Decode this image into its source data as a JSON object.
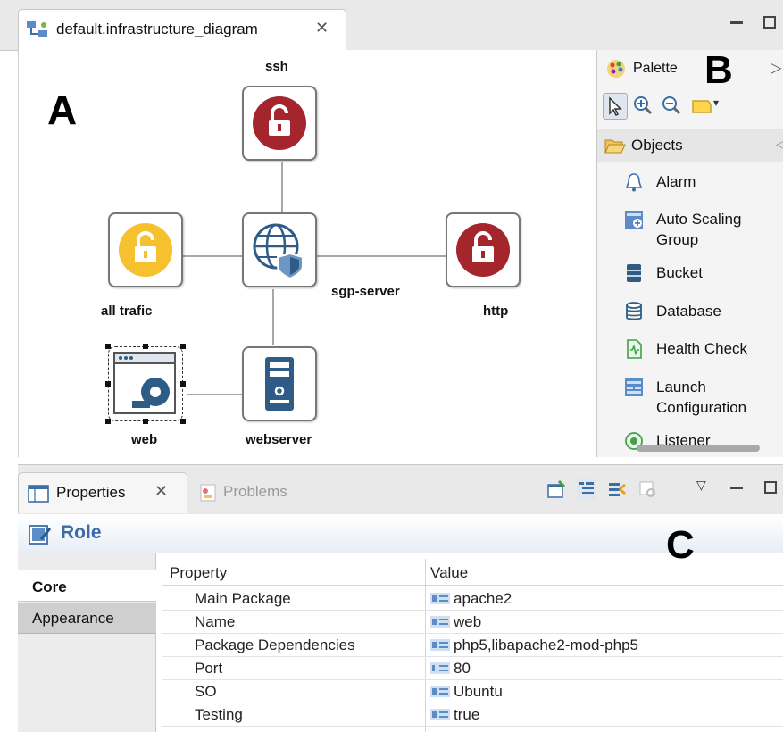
{
  "editor": {
    "tab_title": "default.infrastructure_diagram",
    "tab_close": "✕"
  },
  "canvas": {
    "region_letter": "A",
    "nodes": {
      "ssh": "ssh",
      "all_trafic": "all trafic",
      "sgp_server": "sgp-server",
      "http": "http",
      "web": "web",
      "webserver": "webserver"
    }
  },
  "palette": {
    "title": "Palette",
    "region_letter": "B",
    "drawer": "Objects",
    "items": [
      {
        "label": "Alarm",
        "icon": "bell-icon"
      },
      {
        "label": "Auto Scaling Group",
        "icon": "auto-scaling-icon"
      },
      {
        "label": "Bucket",
        "icon": "bucket-icon"
      },
      {
        "label": "Database",
        "icon": "database-icon"
      },
      {
        "label": "Health Check",
        "icon": "health-check-icon"
      },
      {
        "label": "Launch Configuration",
        "icon": "launch-config-icon"
      },
      {
        "label": "Listener",
        "icon": "listener-icon"
      }
    ]
  },
  "properties_view": {
    "tab_label": "Properties",
    "tab_close": "✕",
    "problems_label": "Problems",
    "region_letter": "C",
    "section_title": "Role",
    "side_tabs": {
      "core": "Core",
      "appearance": "Appearance"
    },
    "columns": {
      "property": "Property",
      "value": "Value"
    },
    "rows": [
      {
        "property": "Main Package",
        "value": "apache2"
      },
      {
        "property": "Name",
        "value": "web"
      },
      {
        "property": "Package Dependencies",
        "value": "php5,libapache2-mod-php5"
      },
      {
        "property": "Port",
        "value": "80"
      },
      {
        "property": "SO",
        "value": "Ubuntu"
      },
      {
        "property": "Testing",
        "value": "true"
      }
    ]
  },
  "colors": {
    "lock_red": "#a4262c",
    "lock_yellow": "#f5c12e",
    "node_blue": "#2f5c86",
    "role_title": "#3d6aa8"
  }
}
